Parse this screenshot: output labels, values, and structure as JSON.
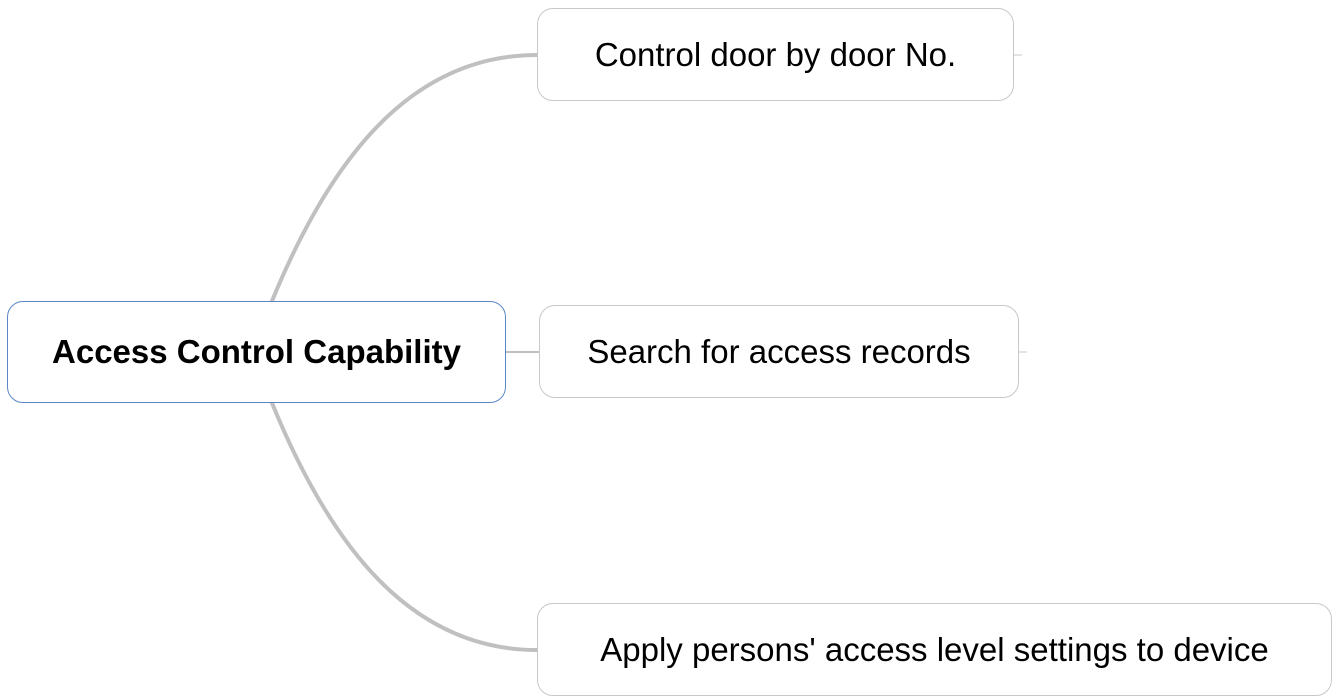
{
  "mindmap": {
    "root": {
      "label": "Access Control Capability"
    },
    "branches": [
      {
        "label": "Control door by door No."
      },
      {
        "label": "Search for access records"
      },
      {
        "label": "Apply persons' access level settings to device"
      }
    ]
  },
  "colors": {
    "root_border": "#5b86c5",
    "node_border": "#c8c8c8",
    "connector": "#c0c0c0",
    "text": "#000000",
    "background": "#ffffff"
  }
}
